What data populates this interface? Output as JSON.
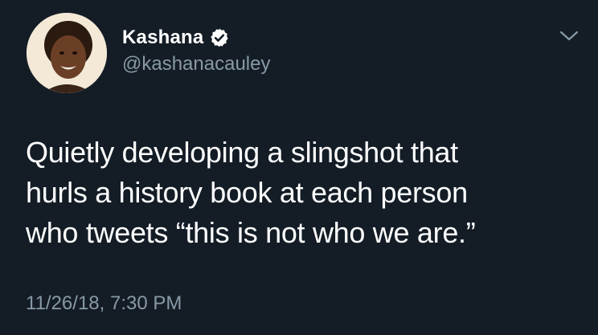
{
  "user": {
    "display_name": "Kashana",
    "handle": "@kashanacauley",
    "verified_icon": "verified-badge-icon",
    "avatar_icon": "avatar"
  },
  "menu": {
    "icon": "chevron-down-icon"
  },
  "tweet": {
    "lines": [
      "Quietly developing a slingshot that",
      "hurls a history book at each person",
      "who tweets “this is not who we are.”"
    ],
    "timestamp": "11/26/18, 7:30 PM"
  },
  "colors": {
    "background": "#141d26",
    "primary_text": "#ffffff",
    "secondary_text": "#8899a6"
  }
}
